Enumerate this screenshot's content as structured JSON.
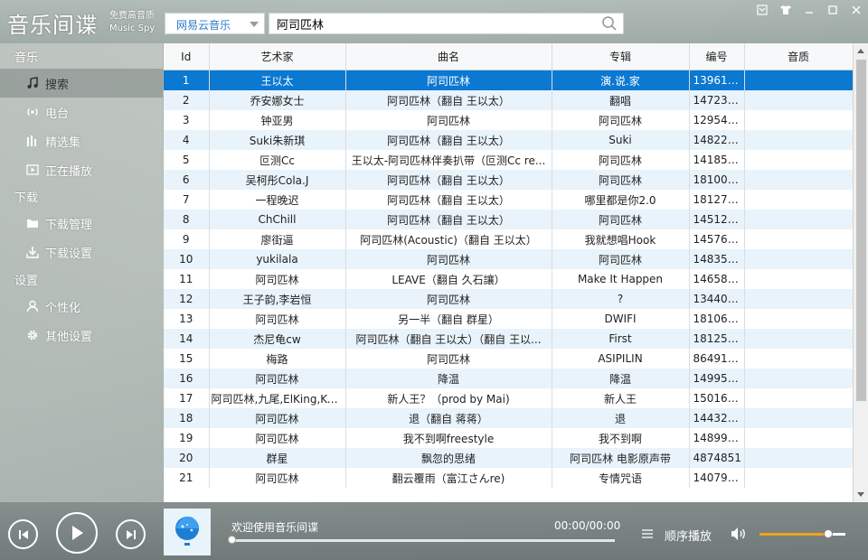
{
  "app": {
    "title": "音乐间谍",
    "subtitle_line1": "免费高音质",
    "subtitle_line2": "Music Spy"
  },
  "search": {
    "source": "网易云音乐",
    "query": "阿司匹林"
  },
  "sidebar": {
    "sections": [
      {
        "title": "音乐",
        "items": [
          {
            "label": "搜索",
            "icon": "music-note-icon",
            "active": true
          },
          {
            "label": "电台",
            "icon": "radio-icon",
            "active": false
          },
          {
            "label": "精选集",
            "icon": "bars-icon",
            "active": false
          },
          {
            "label": "正在播放",
            "icon": "play-box-icon",
            "active": false
          }
        ]
      },
      {
        "title": "下载",
        "items": [
          {
            "label": "下载管理",
            "icon": "folder-icon",
            "active": false
          },
          {
            "label": "下载设置",
            "icon": "download-icon",
            "active": false
          }
        ]
      },
      {
        "title": "设置",
        "items": [
          {
            "label": "个性化",
            "icon": "user-icon",
            "active": false
          },
          {
            "label": "其他设置",
            "icon": "gear-icon",
            "active": false
          }
        ]
      }
    ]
  },
  "table": {
    "headers": [
      "Id",
      "艺术家",
      "曲名",
      "专辑",
      "编号",
      "音质"
    ],
    "rows": [
      [
        "1",
        "王以太",
        "阿司匹林",
        "演.说.家",
        "139614...",
        ""
      ],
      [
        "2",
        "乔安娜女士",
        "阿司匹林（翻自 王以太）",
        "翻唱",
        "147237...",
        ""
      ],
      [
        "3",
        "钟亚男",
        "阿司匹林",
        "阿司匹林",
        "129546...",
        ""
      ],
      [
        "4",
        "Suki朱新琪",
        "阿司匹林（翻自 王以太）",
        "Suki",
        "148220...",
        ""
      ],
      [
        "5",
        "叵测Cc",
        "王以太-阿司匹林伴奏扒带（叵测Cc re...",
        "阿司匹林",
        "141856...",
        ""
      ],
      [
        "6",
        "吴柯彤Cola.J",
        "阿司匹林（翻自 王以太）",
        "阿司匹林",
        "181007...",
        ""
      ],
      [
        "7",
        "一程晚迟",
        "阿司匹林（翻自 王以太）",
        "哪里都是你2.0",
        "181276...",
        ""
      ],
      [
        "8",
        "ChChill",
        "阿司匹林（翻自 王以太）",
        "阿司匹林",
        "145120...",
        ""
      ],
      [
        "9",
        "廖街逼",
        "阿司匹林(Acoustic)（翻自 王以太）",
        "我就想唱Hook",
        "145764...",
        ""
      ],
      [
        "10",
        "yukilala",
        "阿司匹林",
        "阿司匹林",
        "148352...",
        ""
      ],
      [
        "11",
        "阿司匹林",
        "LEAVE（翻自 久石讓）",
        "Make It Happen",
        "146584...",
        ""
      ],
      [
        "12",
        "王子韵,李岩恒",
        "阿司匹林",
        "?",
        "134401...",
        ""
      ],
      [
        "13",
        "阿司匹林",
        "另一半（翻自 群星）",
        "DWIFI",
        "181062...",
        ""
      ],
      [
        "14",
        "杰尼龟cw",
        "阿司匹林（翻自 王以太）（翻自 王以...",
        "First",
        "181252...",
        ""
      ],
      [
        "15",
        "梅路",
        "阿司匹林",
        "ASIPILIN",
        "864917...",
        ""
      ],
      [
        "16",
        "阿司匹林",
        "降温",
        "降温",
        "149959...",
        ""
      ],
      [
        "17",
        "阿司匹林,九尾,ElKing,Ko...",
        "新人王？（prod by Mai)",
        "新人王",
        "150167...",
        ""
      ],
      [
        "18",
        "阿司匹林",
        "退（翻自 蒋蒋）",
        "退",
        "144325...",
        ""
      ],
      [
        "19",
        "阿司匹林",
        "我不到啊freestyle",
        "我不到啊",
        "148995...",
        ""
      ],
      [
        "20",
        "群星",
        "飘忽的思绪",
        "阿司匹林 电影原声带",
        "4874851",
        ""
      ],
      [
        "21",
        "阿司匹林",
        "翻云覆雨（富江さんre)",
        "专情咒语",
        "140795...",
        ""
      ]
    ],
    "selected_row": 0
  },
  "player": {
    "now_playing": "欢迎使用音乐间谍",
    "time": "00:00/00:00",
    "progress": 0.0,
    "play_mode": "顺序播放",
    "volume": 0.8
  },
  "colors": {
    "selected_row": "#0b78d2",
    "alt_row": "#e8f3fb",
    "volume_fill": "#f2a21b",
    "source_text": "#2b7cc8"
  }
}
